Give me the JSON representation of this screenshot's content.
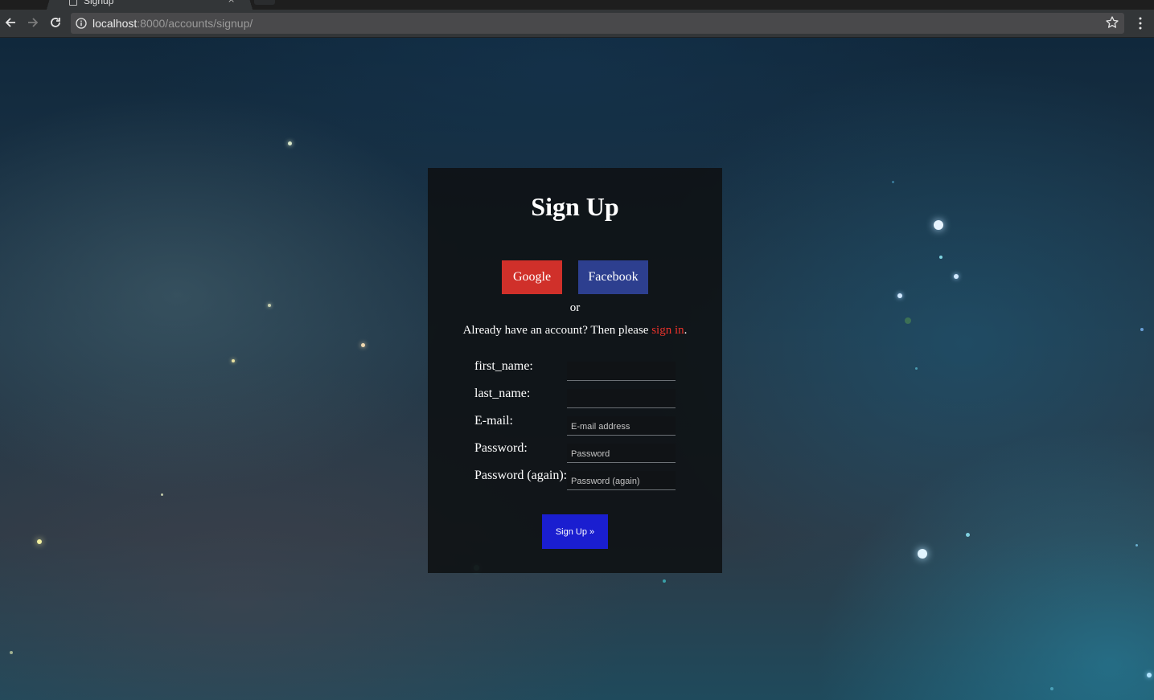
{
  "browser": {
    "tab_title": "Signup",
    "tab_close_glyph": "×",
    "url_host": "localhost",
    "url_path": ":8000/accounts/signup/",
    "back_icon": "back-arrow-icon",
    "forward_icon": "forward-arrow-icon",
    "reload_icon": "reload-icon",
    "info_icon": "info-icon",
    "bookmark_icon": "star-icon",
    "menu_icon": "kebab-menu-icon"
  },
  "signup": {
    "title": "Sign Up",
    "social": {
      "google_label": "Google",
      "facebook_label": "Facebook"
    },
    "or_text": "or",
    "signin_prefix": "Already have an account? Then please ",
    "signin_link": "sign in",
    "signin_suffix": ".",
    "fields": [
      {
        "label": "first_name:",
        "value": "",
        "placeholder": ""
      },
      {
        "label": "last_name:",
        "value": "",
        "placeholder": ""
      },
      {
        "label": "E-mail:",
        "value": "",
        "placeholder": "E-mail address"
      },
      {
        "label": "Password:",
        "value": "",
        "placeholder": "Password"
      },
      {
        "label": "Password (again):",
        "value": "",
        "placeholder": "Password (again)"
      }
    ],
    "submit_label": "Sign Up »"
  },
  "colors": {
    "google_red": "#d0302a",
    "facebook_blue": "#2d3f8f",
    "signin_link": "#e8322b",
    "submit_blue": "#1a1ed0"
  }
}
